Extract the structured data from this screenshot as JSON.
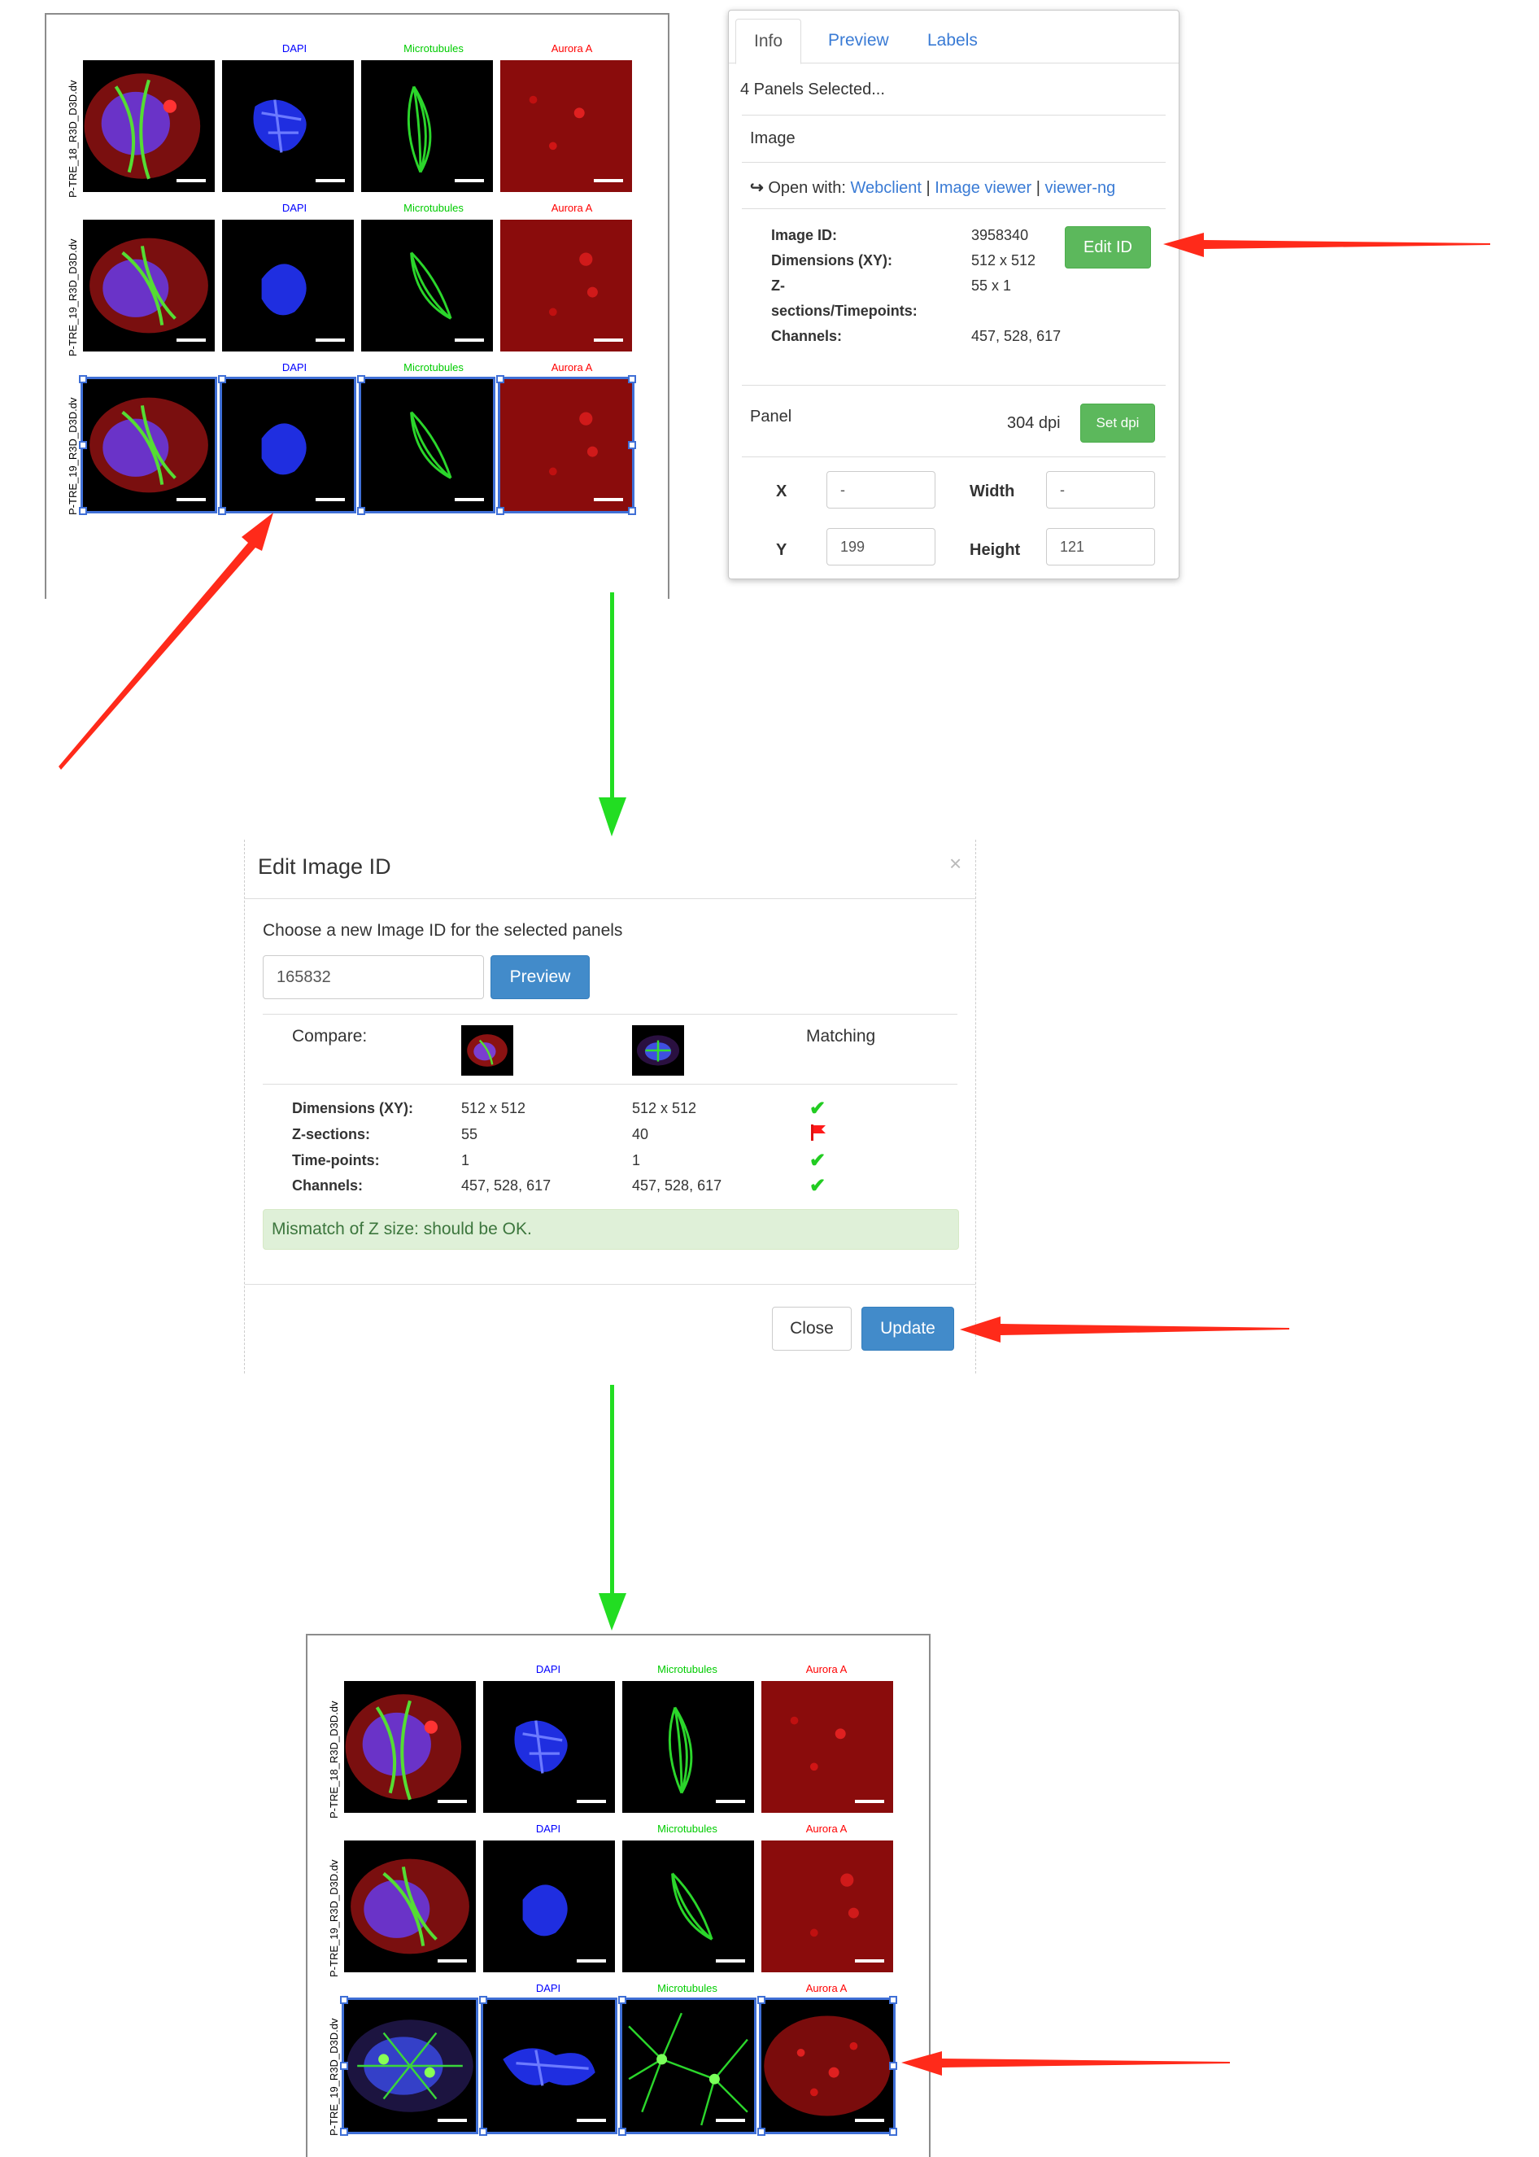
{
  "figure": {
    "channel_labels": [
      "DAPI",
      "Microtubules",
      "Aurora A"
    ],
    "channel_colors": [
      "#0000ff",
      "#00cc00",
      "#ff0000"
    ],
    "row_labels": [
      "P-TRE_18_R3D_D3D.dv",
      "P-TRE_19_R3D_D3D.dv",
      "P-TRE_19_R3D_D3D.dv"
    ]
  },
  "info_panel": {
    "tabs": [
      "Info",
      "Preview",
      "Labels"
    ],
    "selected_text": "4 Panels Selected...",
    "image_heading": "Image",
    "open_with_label": "Open with:",
    "open_with_links": [
      "Webclient",
      "Image viewer",
      "viewer-ng"
    ],
    "separator": "|",
    "fields": [
      {
        "label": "Image ID:",
        "value": "3958340"
      },
      {
        "label": "Dimensions (XY):",
        "value": "512 x 512"
      },
      {
        "label": "Z-",
        "value": "55 x 1"
      },
      {
        "label": "sections/Timepoints:",
        "value": ""
      },
      {
        "label": "Channels:",
        "value": "457, 528, 617"
      }
    ],
    "edit_id_button": "Edit ID",
    "panel_heading": "Panel",
    "dpi_value": "304 dpi",
    "set_dpi_button": "Set dpi",
    "x_label": "X",
    "x_value": "-",
    "y_label": "Y",
    "y_value": "199",
    "width_label": "Width",
    "width_value": "-",
    "height_label": "Height",
    "height_value": "121"
  },
  "modal": {
    "title": "Edit Image ID",
    "close_icon": "×",
    "prompt": "Choose a new Image ID for the selected panels",
    "image_id_value": "165832",
    "preview_button": "Preview",
    "compare_label": "Compare:",
    "matching_label": "Matching",
    "rows": [
      {
        "label": "Dimensions (XY):",
        "old": "512 x 512",
        "new": "512 x 512",
        "match": "check-icon"
      },
      {
        "label": "Z-sections:",
        "old": "55",
        "new": "40",
        "match": "flag-icon"
      },
      {
        "label": "Time-points:",
        "old": "1",
        "new": "1",
        "match": "check-icon"
      },
      {
        "label": "Channels:",
        "old": "457, 528, 617",
        "new": "457, 528, 617",
        "match": "check-icon"
      }
    ],
    "alert_text": "Mismatch of Z size: should be OK.",
    "close_button": "Close",
    "update_button": "Update"
  },
  "colors": {
    "annotation_arrow": "#ff2a1a",
    "flow_arrow": "#22dd22",
    "selection": "#3f6fd6",
    "success": "#5cb85c",
    "primary": "#428bca"
  }
}
